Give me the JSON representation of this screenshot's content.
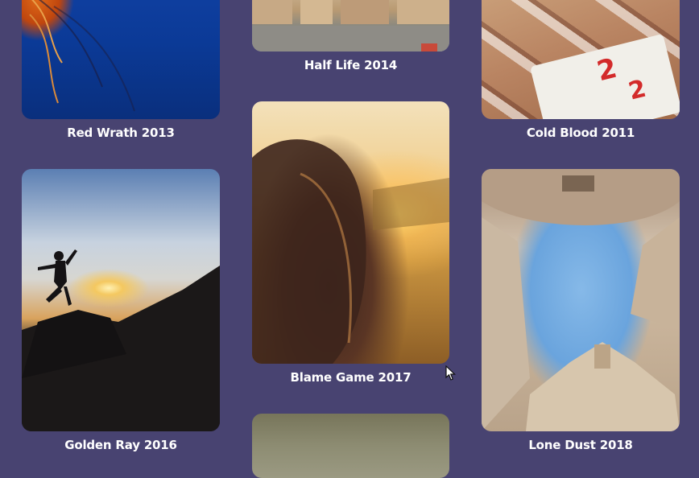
{
  "gallery": {
    "cards": [
      {
        "title": "Red Wrath 2013"
      },
      {
        "title": "Half Life 2014"
      },
      {
        "title": "Cold Blood 2011"
      },
      {
        "title": "Blame Game 2017"
      },
      {
        "title": "Golden Ray 2016"
      },
      {
        "title": "Lone Dust 2018"
      },
      {
        "title": ""
      }
    ]
  },
  "colors": {
    "background": "#484371",
    "caption": "#ffffff"
  },
  "icons": {
    "cursor": "mouse-pointer-icon"
  }
}
